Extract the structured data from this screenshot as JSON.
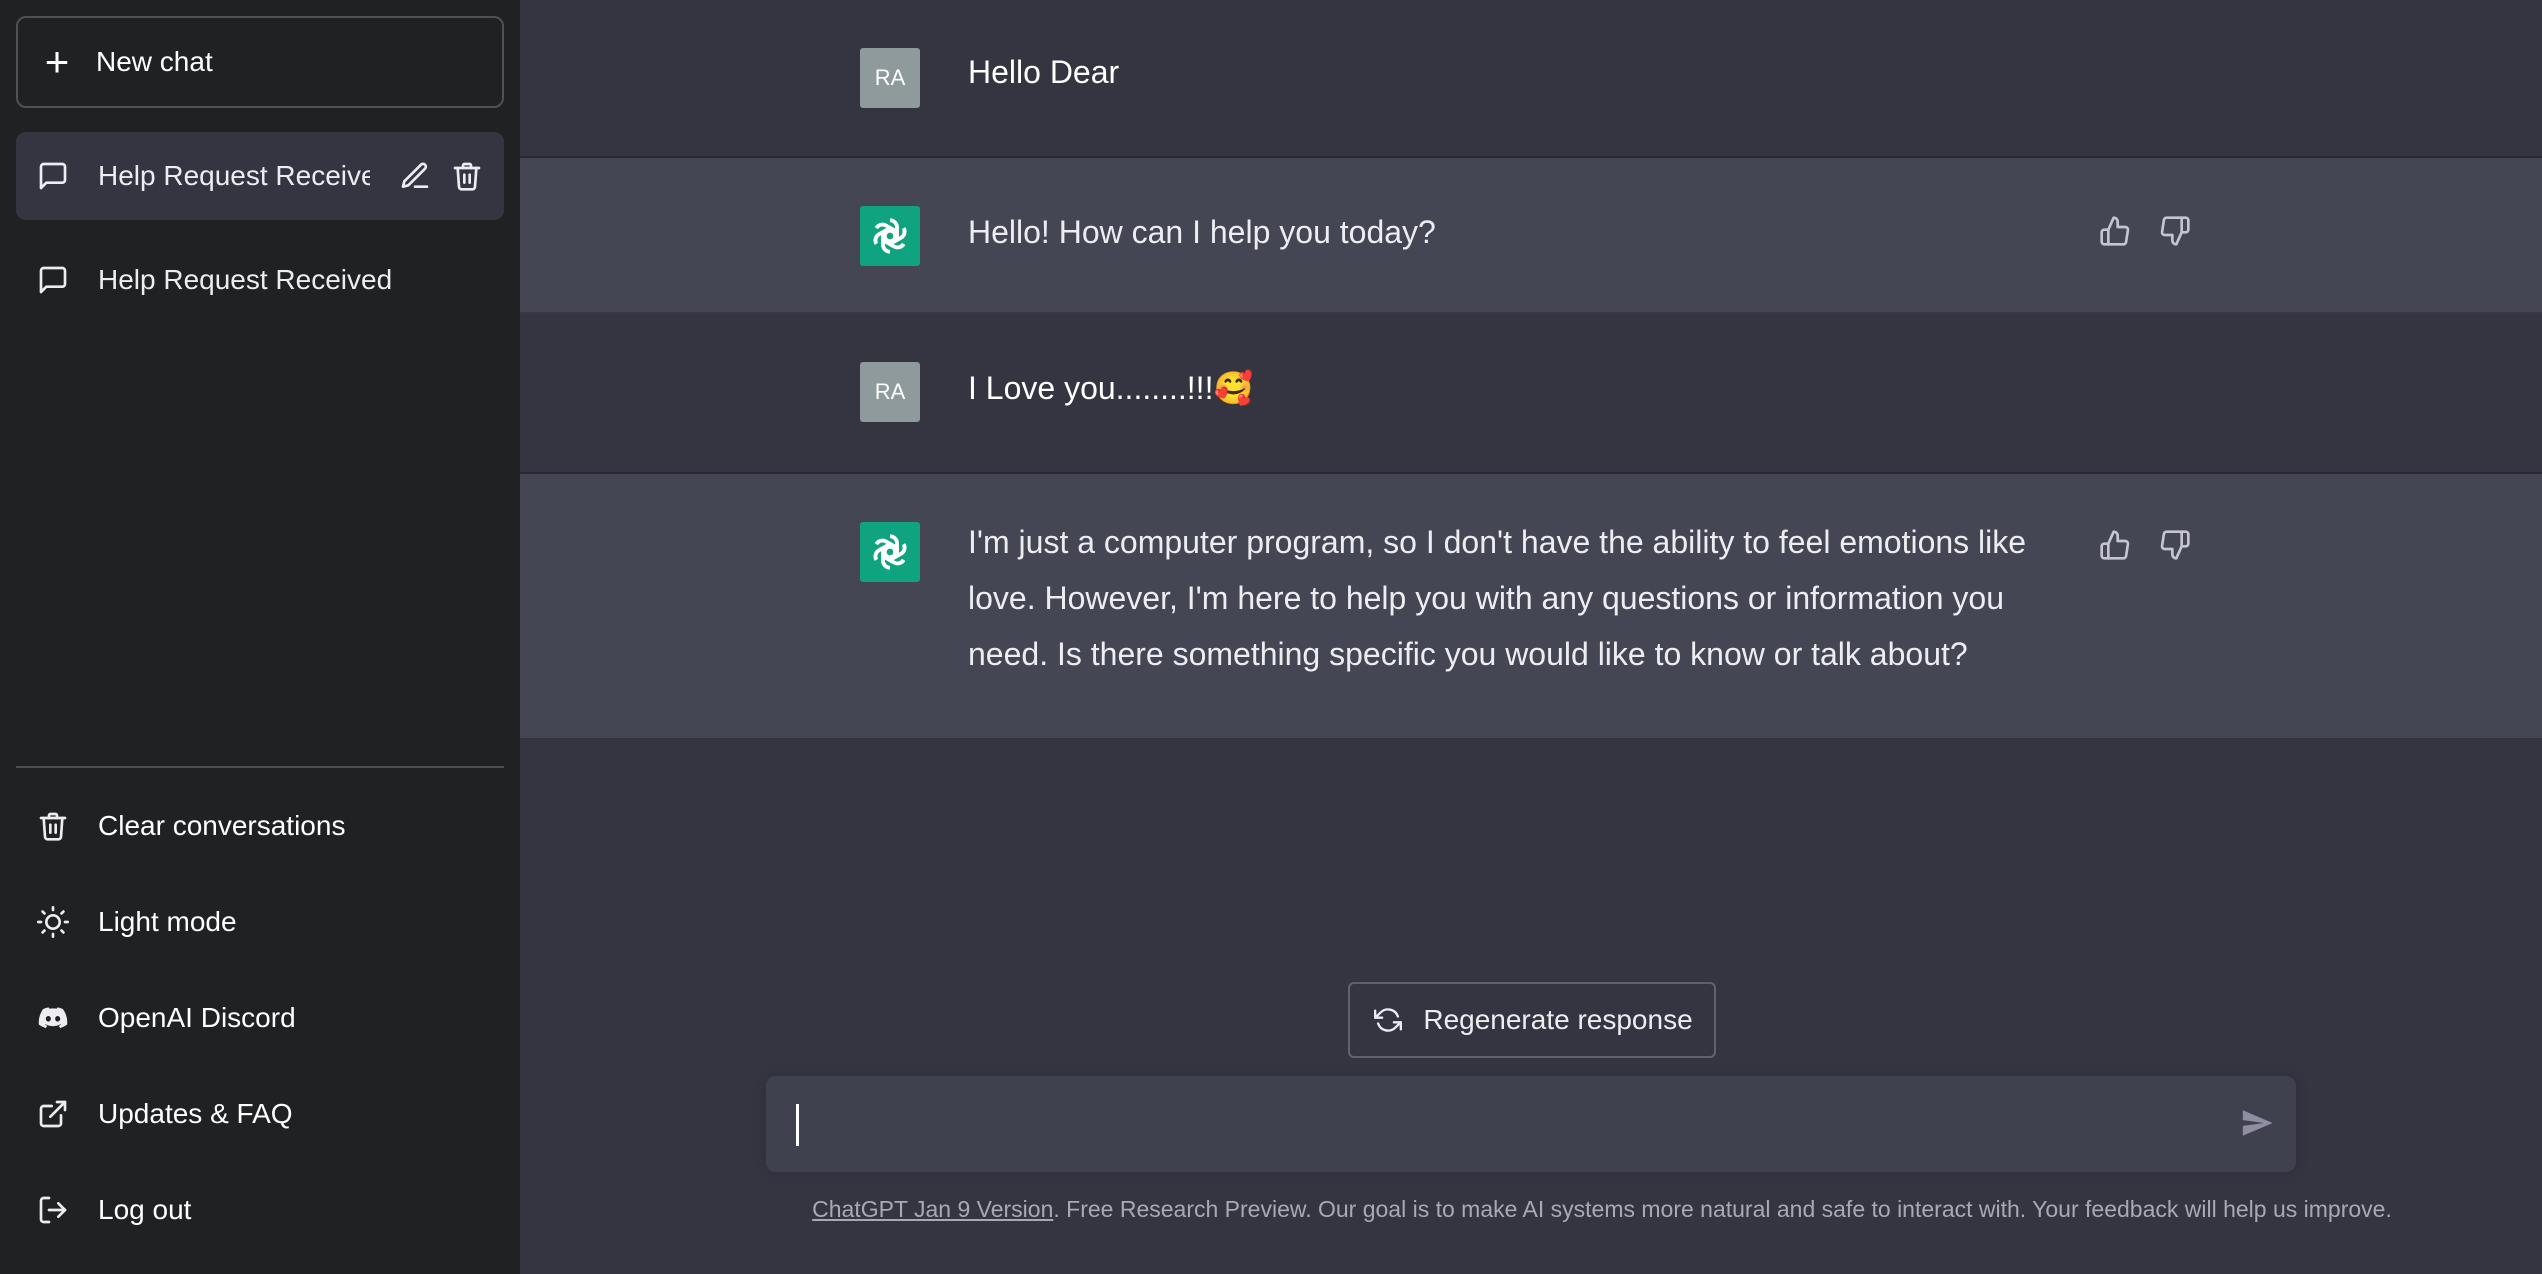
{
  "sidebar": {
    "new_chat_label": "New chat",
    "conversations": [
      {
        "title": "Help Request Receive",
        "active": true
      },
      {
        "title": "Help Request Received",
        "active": false
      }
    ],
    "menu": [
      {
        "label": "Clear conversations",
        "icon": "trash-icon"
      },
      {
        "label": "Light mode",
        "icon": "sun-icon"
      },
      {
        "label": "OpenAI Discord",
        "icon": "discord-icon"
      },
      {
        "label": "Updates & FAQ",
        "icon": "external-link-icon"
      },
      {
        "label": "Log out",
        "icon": "logout-icon"
      }
    ]
  },
  "messages": [
    {
      "role": "user",
      "avatar": "RA",
      "text": "Hello Dear"
    },
    {
      "role": "assistant",
      "text": "Hello! How can I help you today?"
    },
    {
      "role": "user",
      "avatar": "RA",
      "text": "I Love you........!!!🥰"
    },
    {
      "role": "assistant",
      "text": "I'm just a computer program, so I don't have the ability to feel emotions like love. However, I'm here to help you with any questions or information you need. Is there something specific you would like to know or talk about?"
    }
  ],
  "regenerate_label": "Regenerate response",
  "input": {
    "value": "",
    "placeholder": ""
  },
  "footer": {
    "link_text": "ChatGPT Jan 9 Version",
    "text": ". Free Research Preview. Our goal is to make AI systems more natural and safe to interact with. Your feedback will help us improve."
  },
  "colors": {
    "sidebar_bg": "#202123",
    "main_bg": "#343541",
    "bot_row_bg": "#444654",
    "gpt_avatar": "#10a37f",
    "user_avatar": "#8e9a9b"
  }
}
